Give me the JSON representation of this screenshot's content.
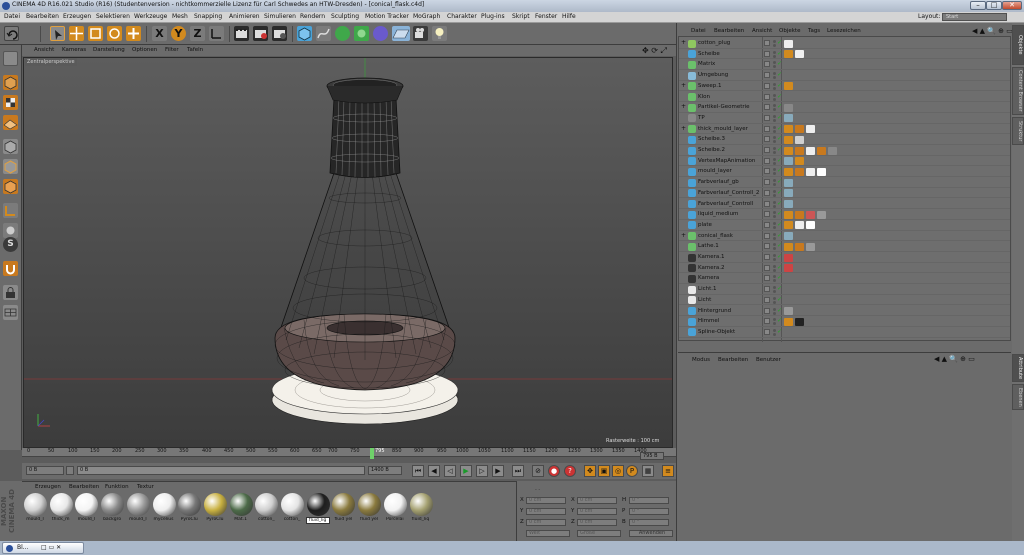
{
  "window": {
    "title": "CINEMA 4D R16.021 Studio (R16) (Studentenversion - nichtkommerzielle Lizenz für Carl Schwedes an HTW-Dresden) - [conical_flask.c4d]",
    "layout_label": "Layout:",
    "layout_value": "Start"
  },
  "menu": [
    "Datei",
    "Bearbeiten",
    "Erzeugen",
    "Selektieren",
    "Werkzeuge",
    "Mesh",
    "Snapping",
    "Animieren",
    "Simulieren",
    "Rendern",
    "Sculpting",
    "Motion Tracker",
    "MoGraph",
    "Charakter",
    "Plug-ins",
    "Skript",
    "Fenster",
    "Hilfe"
  ],
  "viewport_menu": [
    "Ansicht",
    "Kameras",
    "Darstellung",
    "Optionen",
    "Filter",
    "Tafeln"
  ],
  "viewport": {
    "label": "Zentralperspektive",
    "raster": "Rasterweite : 100 cm",
    "colors": {
      "mesh": "#111111",
      "bg_top": "#5d5d5d",
      "bg_bottom": "#3c3c3c"
    }
  },
  "timeline": {
    "ticks": [
      "0",
      "50",
      "100",
      "150",
      "200",
      "250",
      "300",
      "350",
      "400",
      "450",
      "500",
      "550",
      "600",
      "650",
      "700",
      "750",
      "795",
      "850",
      "900",
      "950",
      "1000",
      "1050",
      "1100",
      "1150",
      "1200",
      "1250",
      "1300",
      "1350",
      "1400"
    ],
    "frame_end": "795 B",
    "current_frame": "0 B",
    "start_field": "0 B",
    "end_field": "1400 B"
  },
  "material_menu": [
    "Erzeugen",
    "Bearbeiten",
    "Funktion",
    "Textur"
  ],
  "materials": [
    {
      "label": "mould_l",
      "color": "#d0d0d0"
    },
    {
      "label": "thick_m",
      "color": "#e8e8e8"
    },
    {
      "label": "mould_l",
      "color": "#f4f4f4"
    },
    {
      "label": "backgro",
      "color": "#8a8a8a"
    },
    {
      "label": "mould_l",
      "color": "#9a9a9a"
    },
    {
      "label": "mycelius",
      "color": "#eeeeee"
    },
    {
      "label": "PyroClu",
      "color": "#777777"
    },
    {
      "label": "PyroClu",
      "color": "#c8b040"
    },
    {
      "label": "Mat.1",
      "color": "#4c6a48"
    },
    {
      "label": "cotton_",
      "color": "#cfcfcf"
    },
    {
      "label": "cotton_",
      "color": "#e4e4e4"
    },
    {
      "label": "fluid_lig",
      "color": "#1e1e1e"
    },
    {
      "label": "fluid yel",
      "color": "#8a7a3e"
    },
    {
      "label": "fluid yel",
      "color": "#8a7a3e"
    },
    {
      "label": "Porcelai",
      "color": "#f2f2f2"
    },
    {
      "label": "fluid_liq",
      "color": "#a4a070"
    }
  ],
  "coords": {
    "axes_left": [
      "X",
      "Y",
      "Z"
    ],
    "axes_mid": [
      "X",
      "Y",
      "Z"
    ],
    "axes_right": [
      "H",
      "P",
      "B"
    ],
    "left_values": [
      "0 cm",
      "0 cm",
      "0 cm"
    ],
    "mid_values": [
      "0 cm",
      "0 cm",
      "0 cm"
    ],
    "right_values": [
      "0 °",
      "0 °",
      "0 °"
    ],
    "mode_select": "Welt",
    "size_select": "Größe",
    "apply_button": "Anwenden"
  },
  "object_menu": [
    "Datei",
    "Bearbeiten",
    "Ansicht",
    "Objekte",
    "Tags",
    "Lesezeichen"
  ],
  "objects": [
    {
      "name": "cotton_plug",
      "icon": "#8fc860"
    },
    {
      "name": "Scheibe",
      "icon": "#4aa3d8"
    },
    {
      "name": "Matrix",
      "icon": "#6bc06b"
    },
    {
      "name": "Umgebung",
      "icon": "#88bbd8"
    },
    {
      "name": "Sweep.1",
      "icon": "#6bc06b"
    },
    {
      "name": "Klon",
      "icon": "#6bc06b"
    },
    {
      "name": "Partikel-Geometrie",
      "icon": "#6bc06b"
    },
    {
      "name": "TP",
      "icon": "#888888"
    },
    {
      "name": "thick_mould_layer",
      "icon": "#6bc06b"
    },
    {
      "name": "Scheibe.3",
      "icon": "#4aa3d8"
    },
    {
      "name": "Scheibe.2",
      "icon": "#4aa3d8"
    },
    {
      "name": "VertexMapAnimation",
      "icon": "#4aa3d8"
    },
    {
      "name": "mould_layer",
      "icon": "#4aa3d8"
    },
    {
      "name": "Farbverlauf_gb",
      "icon": "#4aa3d8"
    },
    {
      "name": "Farbverlauf_Controll_2",
      "icon": "#4aa3d8"
    },
    {
      "name": "Farbverlauf_Controll",
      "icon": "#4aa3d8"
    },
    {
      "name": "liquid_medium",
      "icon": "#4aa3d8"
    },
    {
      "name": "plate",
      "icon": "#4aa3d8"
    },
    {
      "name": "conical_flask",
      "icon": "#6bc06b"
    },
    {
      "name": "Lathe.1",
      "icon": "#6bc06b"
    },
    {
      "name": "Kamera.1",
      "icon": "#333333"
    },
    {
      "name": "Kamera.2",
      "icon": "#333333"
    },
    {
      "name": "Kamera",
      "icon": "#333333"
    },
    {
      "name": "Licht.1",
      "icon": "#e8e8e8"
    },
    {
      "name": "Licht",
      "icon": "#e8e8e8"
    },
    {
      "name": "Hintergrund",
      "icon": "#4aa3d8"
    },
    {
      "name": "Himmel",
      "icon": "#4aa3d8"
    },
    {
      "name": "Spline-Objekt",
      "icon": "#4aa3d8"
    }
  ],
  "attr_menu": [
    "Modus",
    "Bearbeiten",
    "Benutzer"
  ],
  "side_tabs": [
    "Objekte",
    "Content Browser",
    "Struktur",
    "Attribute",
    "Ebenen"
  ],
  "taskbar": {
    "button": "Bl..."
  }
}
